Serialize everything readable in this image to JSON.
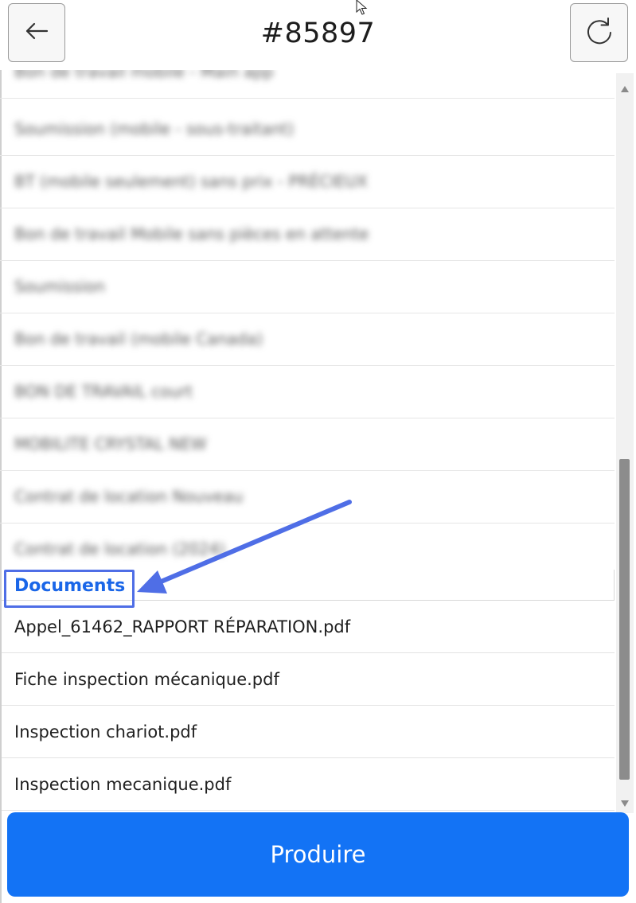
{
  "header": {
    "title": "#85897",
    "back_icon": "arrow-left-icon",
    "refresh_icon": "refresh-icon"
  },
  "blurred_items": [
    "Bon de travail mobile - Main app",
    "Soumission (mobile - sous-traitant)",
    "BT (mobile seulement) sans prix - PRÉCIEUX",
    " Bon de travail Mobile sans pièces en attente",
    "Soumission",
    "Bon de travail (mobile Canada)",
    "BON DE TRAVAIL court",
    "MOBILITE CRYSTAL NEW",
    "Contrat de location Nouveau",
    "Contrat de location (2024)"
  ],
  "documents": {
    "header": "Documents",
    "files": [
      "Appel_61462_RAPPORT RÉPARATION.pdf",
      "Fiche inspection mécanique.pdf",
      "Inspection chariot.pdf",
      "Inspection mecanique.pdf"
    ]
  },
  "footer": {
    "produce_label": "Produire"
  },
  "colors": {
    "accent": "#1373f5",
    "documents_label": "#1a66e8",
    "annotation": "#4f6ee6"
  }
}
